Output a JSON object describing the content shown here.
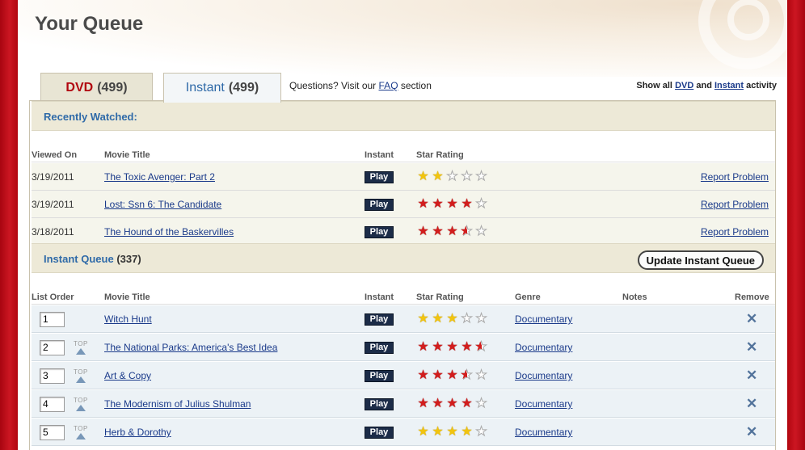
{
  "page": {
    "title": "Your Queue"
  },
  "tabs": [
    {
      "label": "DVD",
      "count": "(499)"
    },
    {
      "label": "Instant",
      "count": "(499)"
    }
  ],
  "help": {
    "prefix": "Questions? Visit our ",
    "link": "FAQ",
    "suffix": " section"
  },
  "activity": {
    "prefix": "Show all ",
    "dvd": "DVD",
    "and": " and ",
    "instant": "Instant",
    "suffix": " activity"
  },
  "recently_watched": {
    "title": "Recently Watched:",
    "columns": [
      "Viewed On",
      "Movie Title",
      "Instant",
      "Star Rating"
    ],
    "rows": [
      {
        "date": "3/19/2011",
        "title": "The Toxic Avenger: Part 2",
        "play": "Play",
        "rating": 2,
        "star_color": "yellow",
        "report": "Report Problem"
      },
      {
        "date": "3/19/2011",
        "title": "Lost: Ssn 6: The Candidate",
        "play": "Play",
        "rating": 4,
        "star_color": "red",
        "report": "Report Problem"
      },
      {
        "date": "3/18/2011",
        "title": "The Hound of the Baskervilles",
        "play": "Play",
        "rating": 3.5,
        "star_color": "red",
        "report": "Report Problem"
      }
    ]
  },
  "instant_queue": {
    "title": "Instant Queue",
    "count": "(337)",
    "update_button": "Update Instant Queue",
    "columns": [
      "List Order",
      "Movie Title",
      "Instant",
      "Star Rating",
      "Genre",
      "Notes",
      "Remove"
    ],
    "top_label": "TOP",
    "remove_glyph": "✕",
    "rows": [
      {
        "order": "1",
        "title": "Witch Hunt",
        "play": "Play",
        "rating": 3,
        "star_color": "yellow",
        "genre": "Documentary",
        "show_top": false
      },
      {
        "order": "2",
        "title": "The National Parks: America's Best Idea",
        "play": "Play",
        "rating": 4.5,
        "star_color": "red",
        "genre": "Documentary",
        "show_top": true
      },
      {
        "order": "3",
        "title": "Art & Copy",
        "play": "Play",
        "rating": 3.5,
        "star_color": "red",
        "genre": "Documentary",
        "show_top": true
      },
      {
        "order": "4",
        "title": "The Modernism of Julius Shulman",
        "play": "Play",
        "rating": 4,
        "star_color": "red",
        "genre": "Documentary",
        "show_top": true
      },
      {
        "order": "5",
        "title": "Herb & Dorothy",
        "play": "Play",
        "rating": 4,
        "star_color": "yellow",
        "genre": "Documentary",
        "show_top": true
      }
    ]
  },
  "colors": {
    "brand_red": "#b1060f",
    "link_blue": "#1a3a8a",
    "heading_blue": "#2f6aa8",
    "play_navy": "#1c2c48"
  }
}
